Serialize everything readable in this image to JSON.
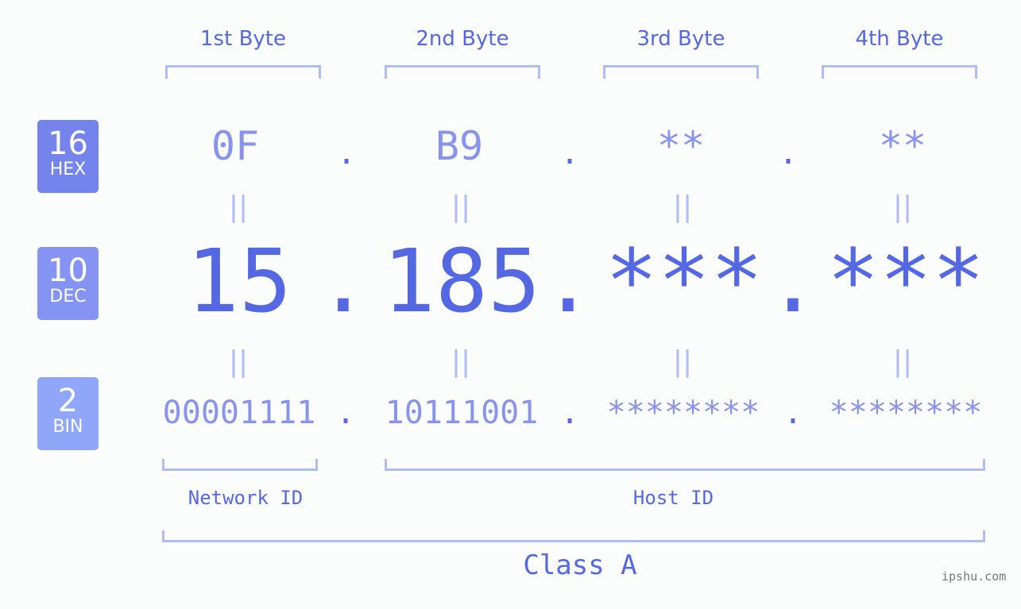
{
  "bytes": {
    "headers": [
      "1st Byte",
      "2nd Byte",
      "3rd Byte",
      "4th Byte"
    ]
  },
  "bases": {
    "hex": {
      "num": "16",
      "name": "HEX",
      "color": "#7584ec"
    },
    "dec": {
      "num": "10",
      "name": "DEC",
      "color": "#8593f2"
    },
    "bin": {
      "num": "2",
      "name": "BIN",
      "color": "#90a6f8"
    }
  },
  "values": {
    "hex": [
      "0F",
      "B9",
      "**",
      "**"
    ],
    "dec": [
      "15",
      "185",
      "***",
      "***"
    ],
    "bin": [
      "00001111",
      "10111001",
      "********",
      "********"
    ],
    "separator": ".",
    "equals": "||"
  },
  "segments": {
    "network": "Network ID",
    "host": "Host ID",
    "class": "Class A"
  },
  "watermark": "ipshu.com",
  "colors": {
    "accent": "#5468e4",
    "light": "#8793ec",
    "bracket": "#b1bcf6"
  }
}
